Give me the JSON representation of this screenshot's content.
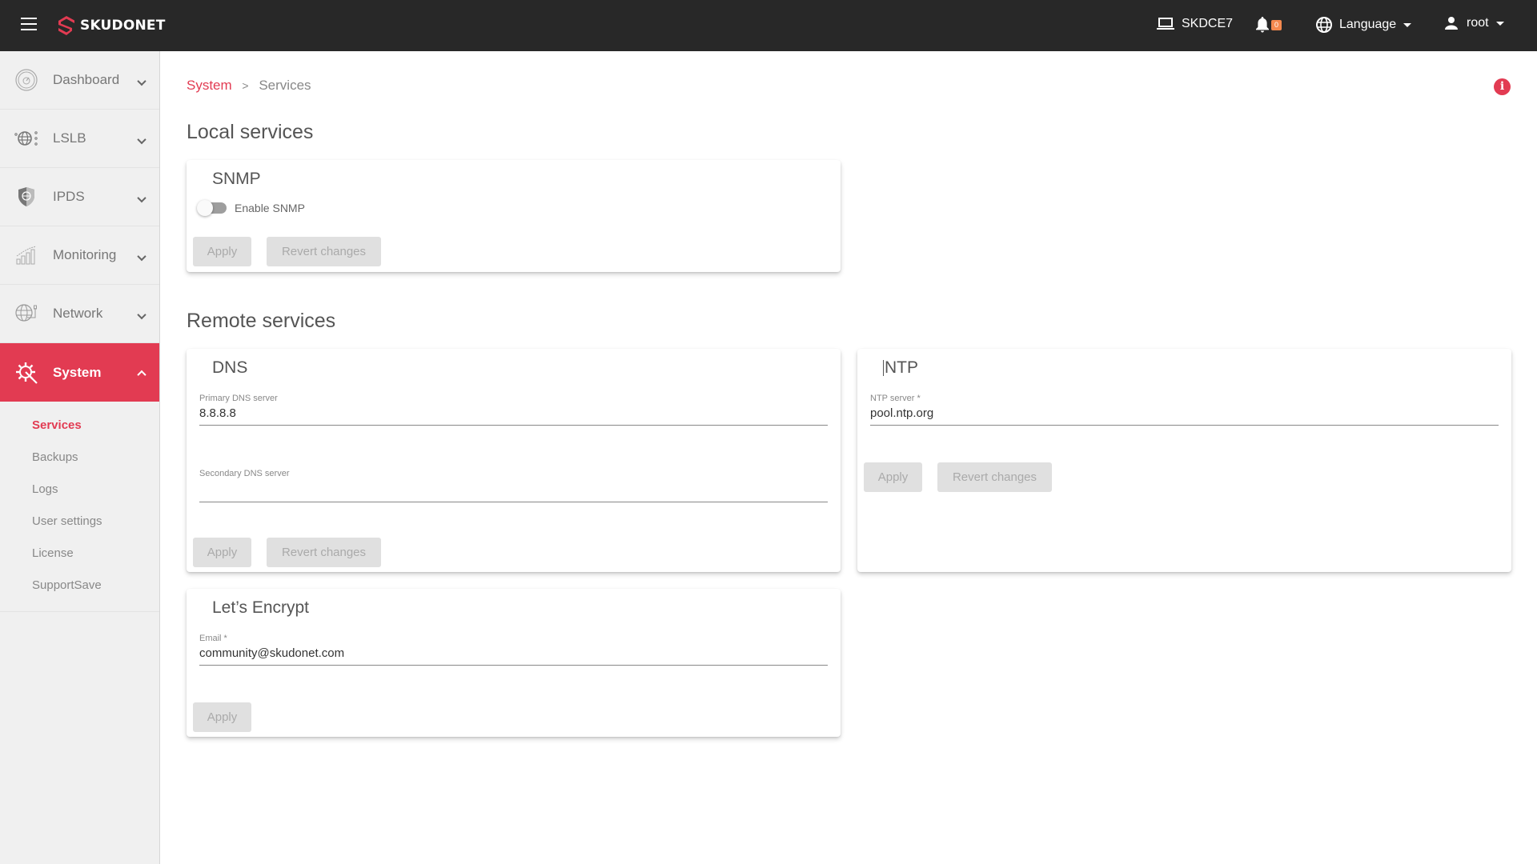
{
  "topbar": {
    "brand": "SKUDONET",
    "hostname": "SKDCE7",
    "notifications_count": "0",
    "language_label": "Language",
    "user_label": "root",
    "colors": {
      "background": "#282828",
      "brand_red": "#e23b52",
      "badge": "#f4894f"
    }
  },
  "sidebar": {
    "items": [
      {
        "label": "Dashboard",
        "icon": "gauge-icon",
        "expanded": false
      },
      {
        "label": "LSLB",
        "icon": "globe-network-icon",
        "expanded": false
      },
      {
        "label": "IPDS",
        "icon": "shield-globe-icon",
        "expanded": false
      },
      {
        "label": "Monitoring",
        "icon": "bar-chart-icon",
        "expanded": false
      },
      {
        "label": "Network",
        "icon": "globe-cable-icon",
        "expanded": false
      },
      {
        "label": "System",
        "icon": "gear-wrench-icon",
        "expanded": true,
        "active": true
      }
    ],
    "system_submenu": [
      {
        "label": "Services",
        "active": true
      },
      {
        "label": "Backups"
      },
      {
        "label": "Logs"
      },
      {
        "label": "User settings"
      },
      {
        "label": "License"
      },
      {
        "label": "SupportSave"
      }
    ]
  },
  "breadcrumb": {
    "parent": "System",
    "separator": ">",
    "current": "Services"
  },
  "info_icon": "i",
  "sections": {
    "local_title": "Local services",
    "remote_title": "Remote services"
  },
  "snmp": {
    "title": "SNMP",
    "toggle_label": "Enable SNMP",
    "enabled": false,
    "apply_label": "Apply",
    "revert_label": "Revert changes"
  },
  "dns": {
    "title": "DNS",
    "primary_label": "Primary DNS server",
    "primary_value": "8.8.8.8",
    "secondary_label": "Secondary DNS server",
    "secondary_value": "",
    "apply_label": "Apply",
    "revert_label": "Revert changes"
  },
  "ntp": {
    "title": "NTP",
    "server_label": "NTP server *",
    "server_value": "pool.ntp.org",
    "apply_label": "Apply",
    "revert_label": "Revert changes"
  },
  "letsencrypt": {
    "title": "Let’s Encrypt",
    "email_label": "Email *",
    "email_value": "community@skudonet.com",
    "apply_label": "Apply"
  }
}
